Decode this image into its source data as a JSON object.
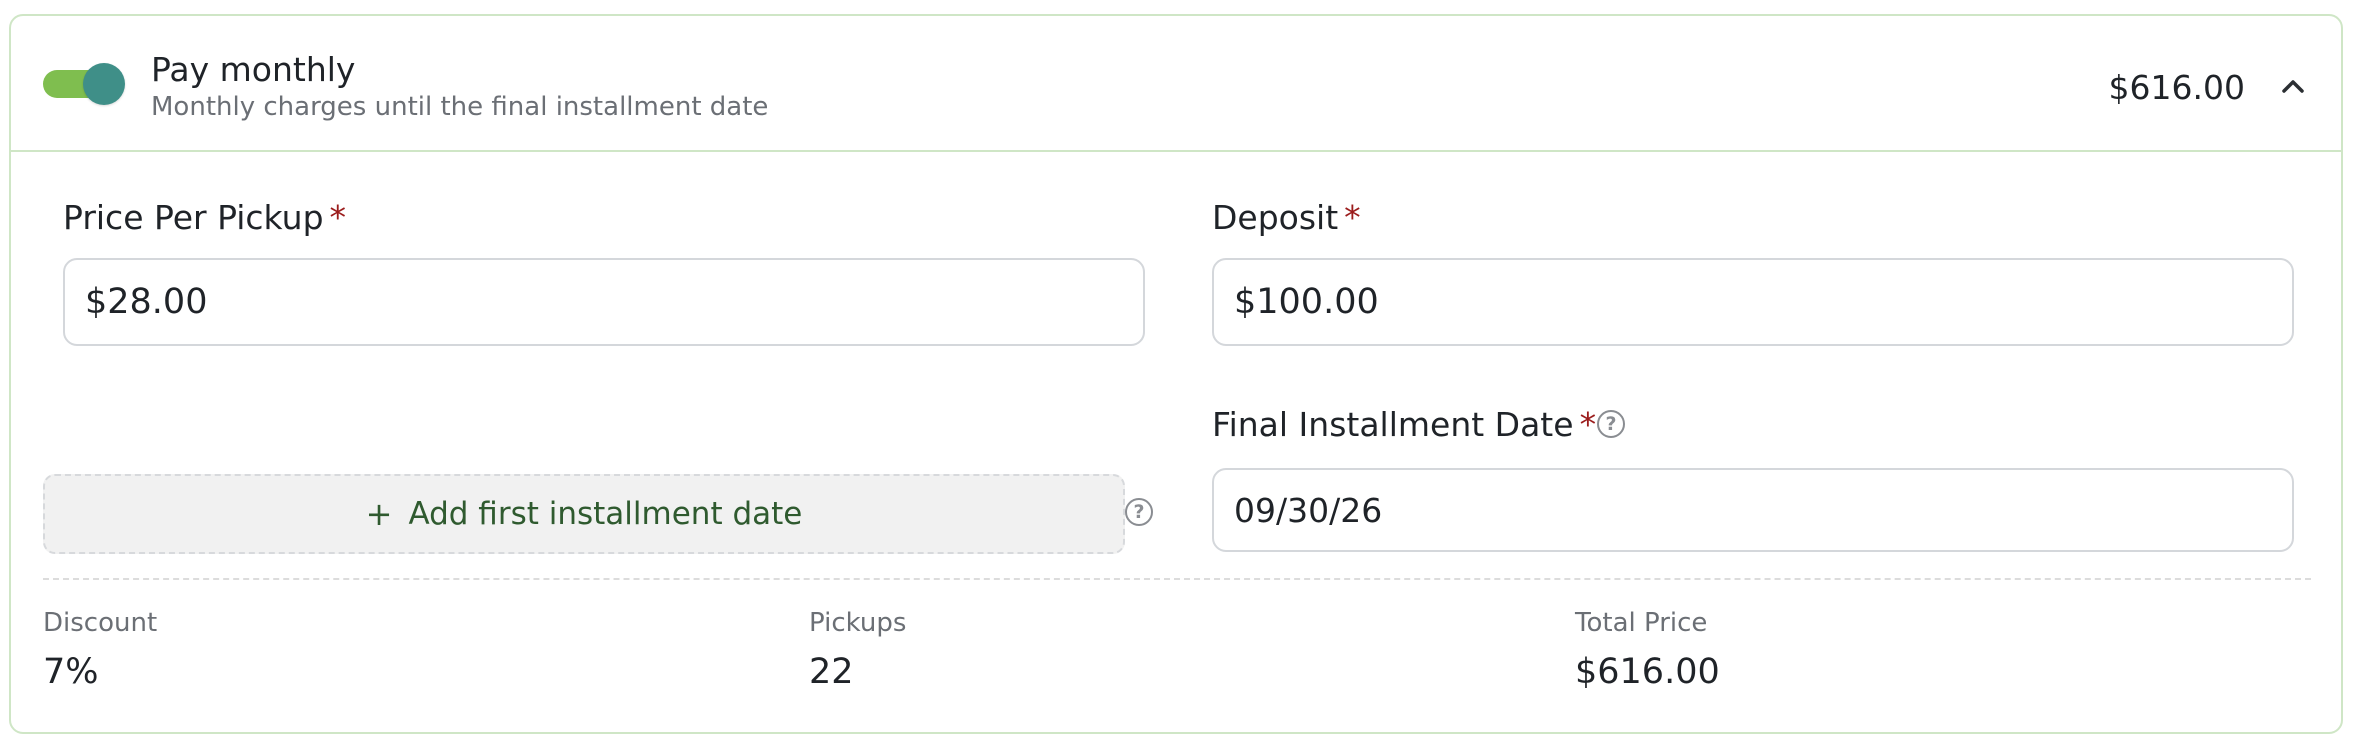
{
  "header": {
    "title": "Pay monthly",
    "subtitle": "Monthly charges until the final installment date",
    "amount": "$616.00",
    "toggle_on": true,
    "chevron_icon": "chevron-up-icon"
  },
  "fields": {
    "price_per_pickup": {
      "label": "Price Per Pickup",
      "required_mark": "*",
      "value": "$28.00"
    },
    "deposit": {
      "label": "Deposit",
      "required_mark": "*",
      "value": "$100.00"
    },
    "final_installment_date": {
      "label": "Final Installment Date",
      "required_mark": "*",
      "value": "09/30/26",
      "help_icon": "question-circle-icon"
    }
  },
  "add_first_installment": {
    "plus": "+",
    "label": "Add first installment date",
    "help_icon": "question-circle-icon"
  },
  "summary": {
    "discount": {
      "label": "Discount",
      "value": "7%"
    },
    "pickups": {
      "label": "Pickups",
      "value": "22"
    },
    "total_price": {
      "label": "Total Price",
      "value": "$616.00"
    }
  },
  "colors": {
    "toggle_track": "#7fbe4f",
    "toggle_knob": "#3f8f88",
    "card_border": "#cfe6c6",
    "required": "#9b1c1c",
    "add_button_text": "#2f5a2f"
  }
}
